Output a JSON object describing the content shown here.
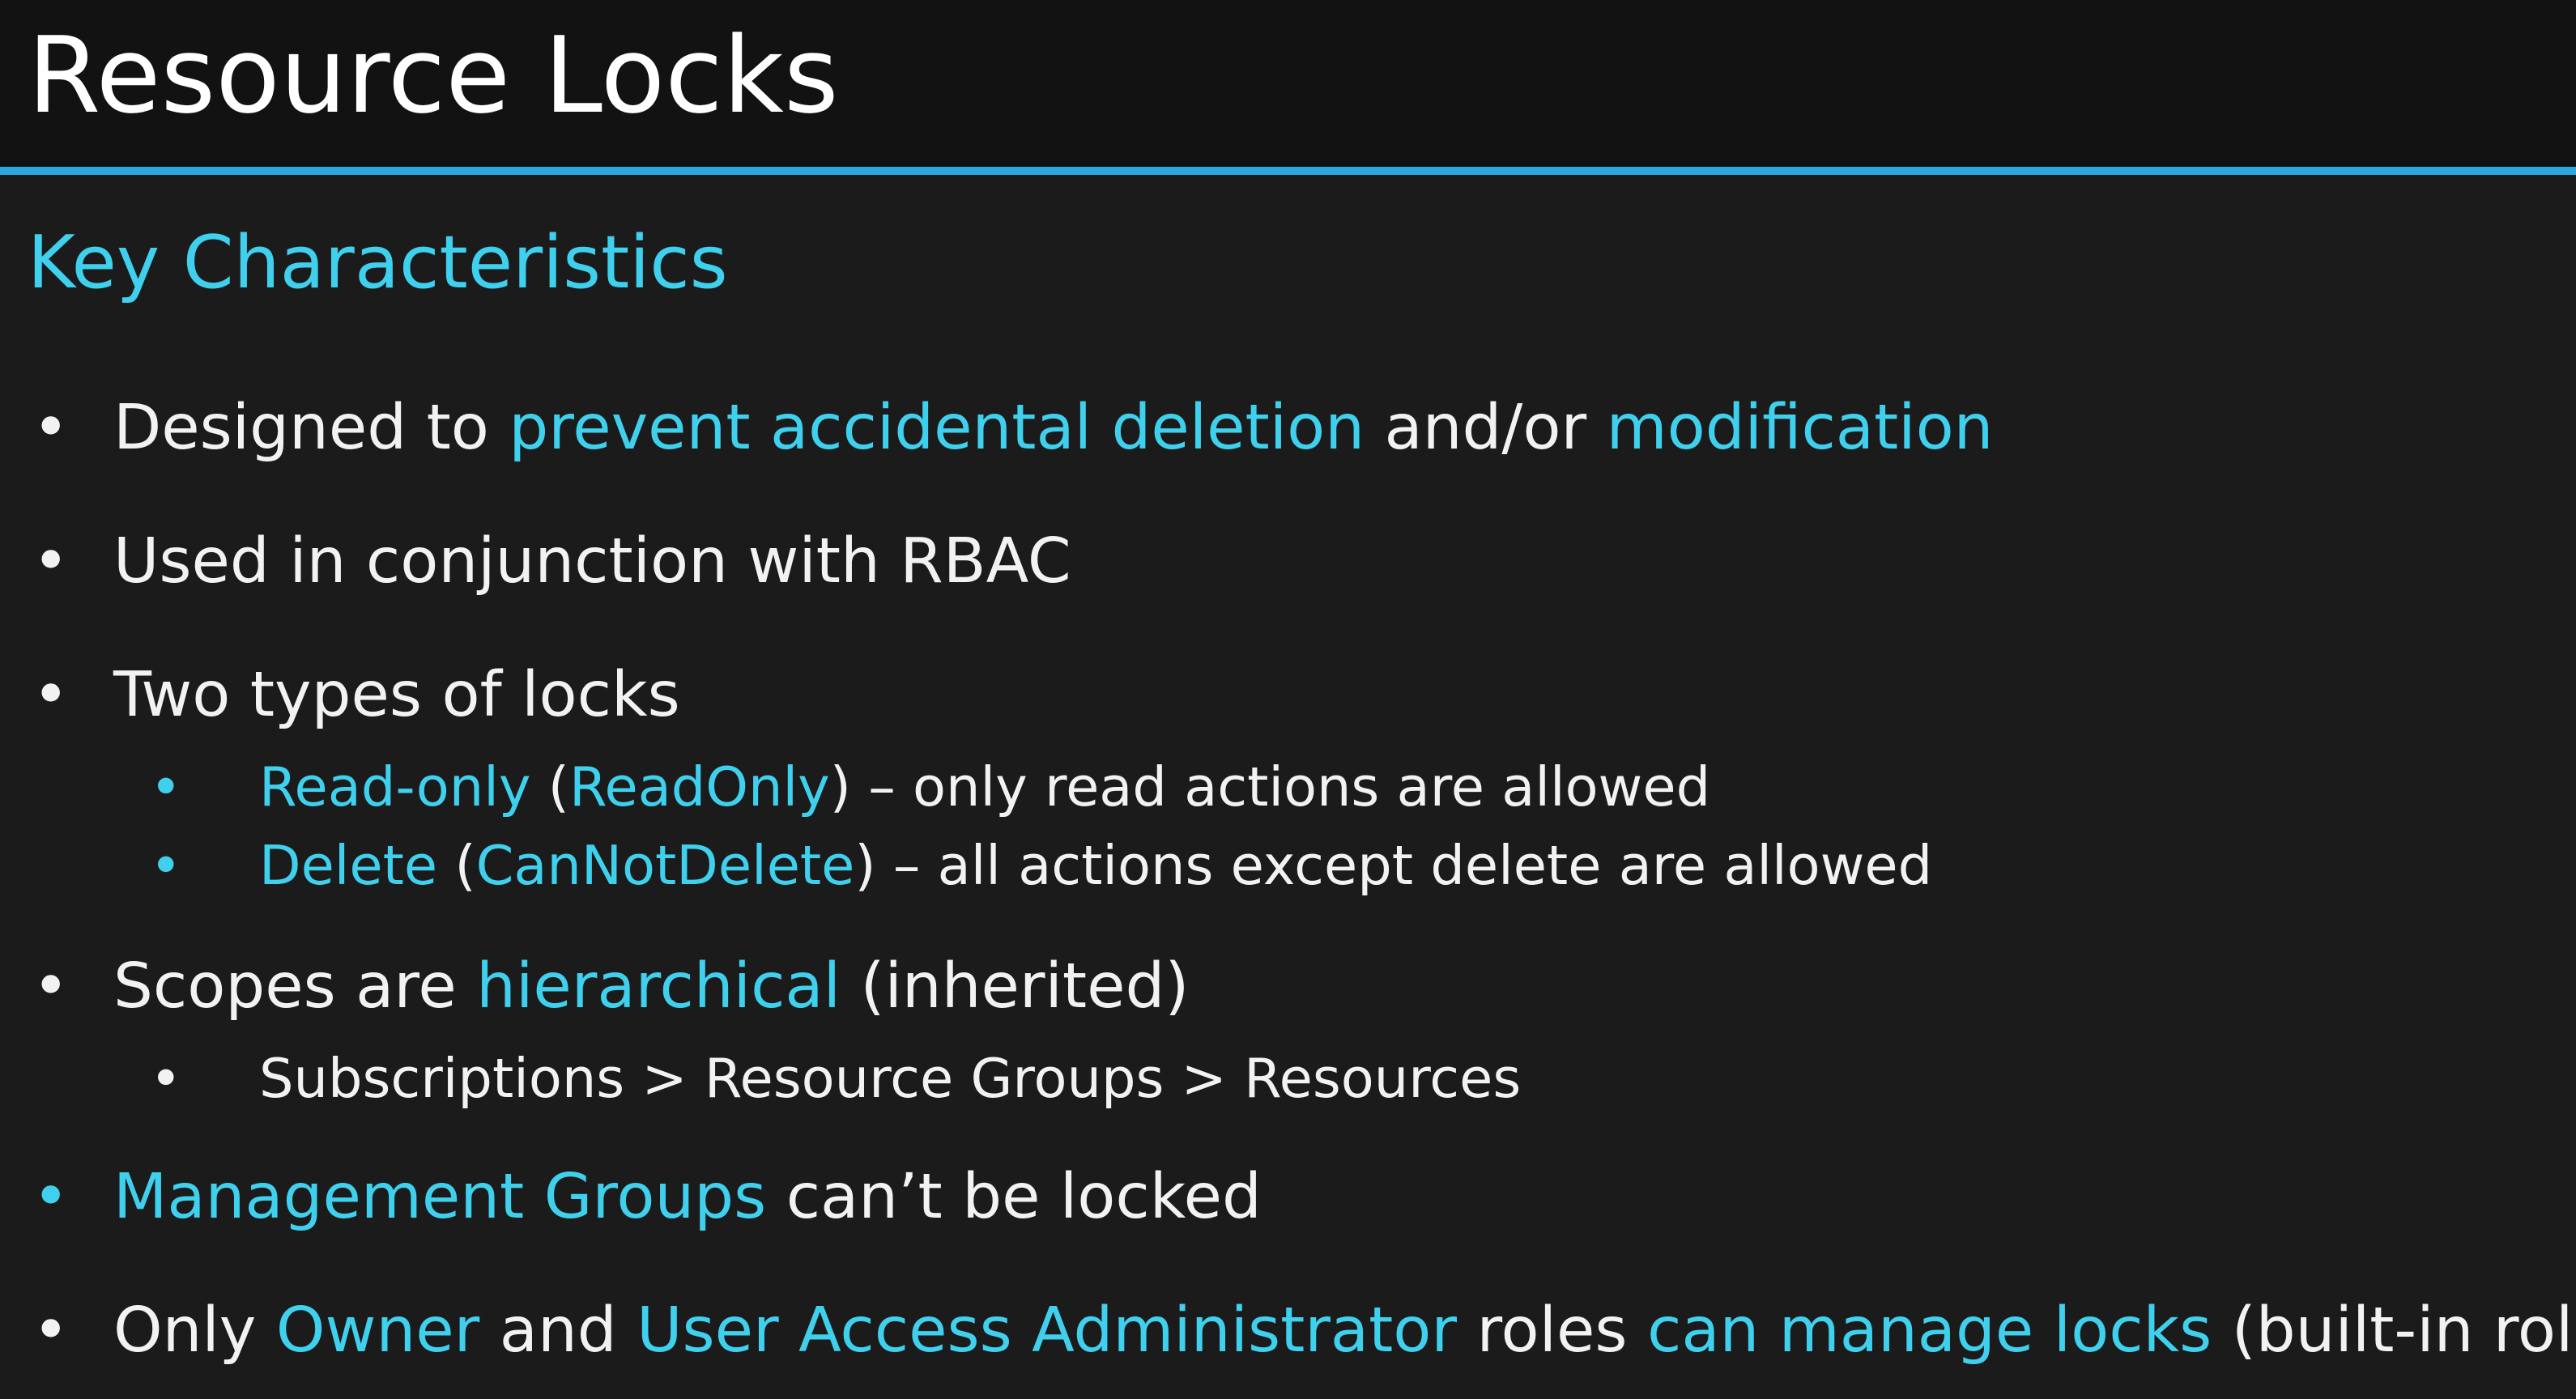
{
  "slide": {
    "title": "Resource Locks",
    "subtitle": "Key Characteristics",
    "accent_color": "#3fd0ee",
    "rule_color": "#2ba8e0",
    "bullet_glyph": "•"
  },
  "items": {
    "designed": {
      "t1": "Designed to ",
      "h1": "prevent accidental deletion",
      "t2": " and/or ",
      "h2": "modification"
    },
    "rbac": {
      "t1": "Used in conjunction with RBAC"
    },
    "lock_types": {
      "t1": "Two types of locks"
    },
    "read_only": {
      "h1": "Read-only",
      "t1": " (",
      "h2": "ReadOnly",
      "t2": ") – only read actions are allowed"
    },
    "delete": {
      "h1": "Delete",
      "t1": " (",
      "h2": "CanNotDelete",
      "t2": ") – all actions except delete are allowed"
    },
    "scopes": {
      "t1": "Scopes are ",
      "h1": "hierarchical",
      "t2": " (inherited)"
    },
    "scope_chain": {
      "t1": "Subscriptions > Resource Groups > Resources"
    },
    "mgmt_groups": {
      "h1": "Management Groups",
      "t1": " can’t be locked"
    },
    "roles": {
      "t1": "Only ",
      "h1": "Owner",
      "t2": " and ",
      "h2": "User Access Administrator",
      "t3": " roles ",
      "h3": "can manage locks",
      "t4": " (built-in roles)"
    }
  }
}
